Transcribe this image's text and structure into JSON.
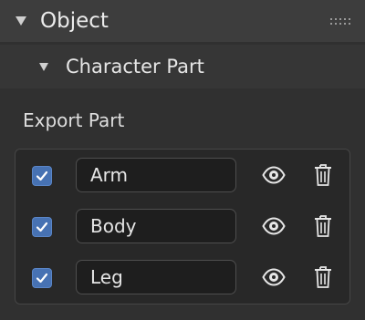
{
  "object_panel": {
    "title": "Object",
    "expand_icon": "triangle-down-icon",
    "drag_icon": "drag-handle-icon"
  },
  "character_part": {
    "title": "Character Part",
    "expand_icon": "triangle-down-icon"
  },
  "export_section": {
    "label": "Export Part",
    "rows": [
      {
        "name": "Arm",
        "checked": true,
        "visible_icon": "eye-icon",
        "delete_icon": "trash-icon"
      },
      {
        "name": "Body",
        "checked": true,
        "visible_icon": "eye-icon",
        "delete_icon": "trash-icon"
      },
      {
        "name": "Leg",
        "checked": true,
        "visible_icon": "eye-icon",
        "delete_icon": "trash-icon"
      }
    ]
  },
  "colors": {
    "panel_bg": "#303030",
    "header_bg": "#3d3d3d",
    "checkbox_accent": "#4772b3",
    "field_bg": "#1e1e1e"
  }
}
